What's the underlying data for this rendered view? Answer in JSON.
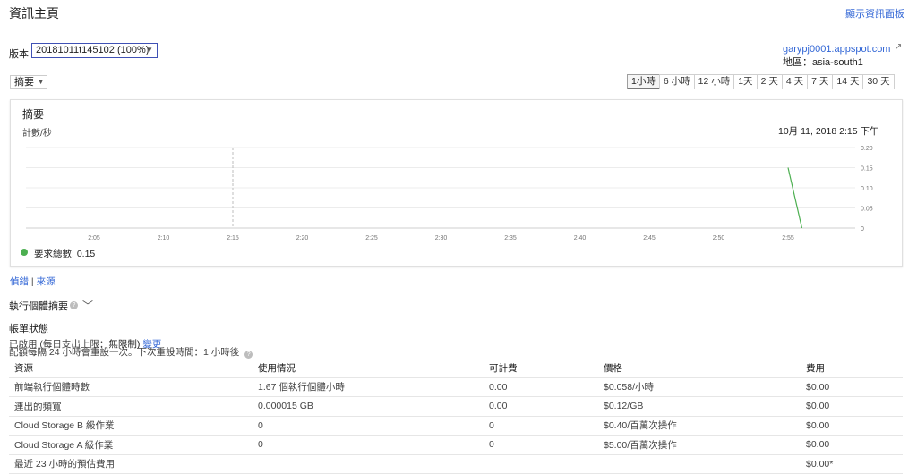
{
  "header": {
    "title": "資訊主頁",
    "show_dashboard": "顯示資訊面板"
  },
  "version": {
    "label": "版本",
    "selected": "20181011t145102 (100%)"
  },
  "app": {
    "url": "garypj0001.appspot.com",
    "region": "地區：asia-south1"
  },
  "summary_select": "摘要",
  "time_ranges": [
    "1小時",
    "6 小時",
    "12 小時",
    "1天",
    "2 天",
    "4 天",
    "7 天",
    "14 天",
    "30 天"
  ],
  "active_time_range": 0,
  "chart": {
    "title": "摘要",
    "ylabel": "計數/秒",
    "date": "10月 11, 2018 2:15 下午",
    "legend": "要求總數: 0.15"
  },
  "chart_data": {
    "type": "line",
    "title": "摘要",
    "ylabel": "計數/秒",
    "x_ticks": [
      "2:05",
      "2:10",
      "2:15",
      "2:20",
      "2:25",
      "2:30",
      "2:35",
      "2:40",
      "2:45",
      "2:50",
      "2:55"
    ],
    "y_ticks": [
      "0",
      "0.05",
      "0.10",
      "0.15",
      "0.20"
    ],
    "ylim": [
      0,
      0.2
    ],
    "marker_x": "2:15",
    "series": [
      {
        "name": "要求總數",
        "color": "#4caf50",
        "points": [
          [
            "2:55",
            0.15
          ],
          [
            "2:56",
            0
          ]
        ]
      }
    ]
  },
  "links": {
    "debug": "偵錯",
    "source": "來源"
  },
  "instances": {
    "title": "執行個體摘要"
  },
  "billing": {
    "title": "帳單狀態",
    "status_prefix": "已啟用 (每日支出上限：",
    "status_value": "無限制)",
    "change": "變更",
    "reset": "配額每隔 24 小時會重設一次。下次重設時間：1 小時後"
  },
  "table": {
    "headers": [
      "資源",
      "使用情況",
      "可計費",
      "價格",
      "費用"
    ],
    "rows": [
      [
        "前端執行個體時數",
        "1.67 個執行個體小時",
        "0.00",
        "$0.058/小時",
        "$0.00"
      ],
      [
        "連出的頻寬",
        "0.000015 GB",
        "0.00",
        "$0.12/GB",
        "$0.00"
      ],
      [
        "Cloud Storage B 級作業",
        "0",
        "0",
        "$0.40/百萬次操作",
        "$0.00"
      ],
      [
        "Cloud Storage A 級作業",
        "0",
        "0",
        "$5.00/百萬次操作",
        "$0.00"
      ],
      [
        "最近 23 小時的預估費用",
        "",
        "",
        "",
        "$0.00*"
      ]
    ]
  }
}
